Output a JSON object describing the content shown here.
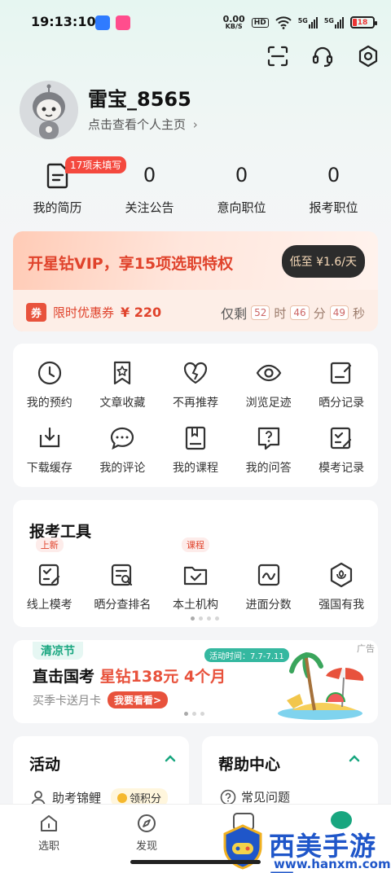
{
  "status_bar": {
    "time": "19:13:10",
    "net_speed_top": "0.00",
    "net_speed_bottom": "KB/S",
    "hd": "HD",
    "sig1": "5G",
    "sig2": "5G",
    "battery": "18"
  },
  "header_icons": [
    "scan-icon",
    "headset-icon",
    "settings-icon"
  ],
  "profile": {
    "username": "雷宝_8565",
    "subtitle": "点击查看个人主页",
    "subtitle_arrow": "›"
  },
  "stats": [
    {
      "value": "",
      "label": "我的简历",
      "badge": "17项未填写",
      "icon": "resume-icon"
    },
    {
      "value": "0",
      "label": "关注公告"
    },
    {
      "value": "0",
      "label": "意向职位"
    },
    {
      "value": "0",
      "label": "报考职位"
    }
  ],
  "vip": {
    "title": "开星钻VIP，享15项选职特权",
    "button": "低至 ¥1.6/天",
    "coupon_tag": "券",
    "coupon_text": "限时优惠券",
    "coupon_amount": "¥ 220",
    "countdown_prefix": "仅剩",
    "hours": "52",
    "hours_unit": "时",
    "minutes": "46",
    "minutes_unit": "分",
    "seconds": "49",
    "seconds_unit": "秒"
  },
  "quick_grid": [
    {
      "label": "我的预约",
      "icon": "clock-icon"
    },
    {
      "label": "文章收藏",
      "icon": "bookmark-star-icon"
    },
    {
      "label": "不再推荐",
      "icon": "broken-heart-icon"
    },
    {
      "label": "浏览足迹",
      "icon": "eye-icon"
    },
    {
      "label": "晒分记录",
      "icon": "edit-note-icon"
    },
    {
      "label": "下载缓存",
      "icon": "download-icon"
    },
    {
      "label": "我的评论",
      "icon": "comment-icon"
    },
    {
      "label": "我的课程",
      "icon": "course-book-icon"
    },
    {
      "label": "我的问答",
      "icon": "question-icon"
    },
    {
      "label": "模考记录",
      "icon": "exam-record-icon"
    }
  ],
  "tools": {
    "title": "报考工具",
    "items": [
      {
        "label": "线上模考",
        "tag": "上新",
        "icon": "mock-exam-icon"
      },
      {
        "label": "晒分查排名",
        "tag": "",
        "icon": "rank-search-icon"
      },
      {
        "label": "本土机构",
        "tag": "课程",
        "icon": "folder-check-icon"
      },
      {
        "label": "进面分数",
        "tag": "",
        "icon": "score-wave-icon"
      },
      {
        "label": "强国有我",
        "tag": "",
        "icon": "hexagon-flower-icon"
      }
    ]
  },
  "ad": {
    "label": "清凉节",
    "ad_mark": "广告",
    "activity_time": "活动时间：7.7-7.11",
    "headline_a": "直击国考",
    "headline_b": "星钻138元 4个月",
    "subline": "买季卡送月卡",
    "cta": "我要看看>"
  },
  "activity": {
    "title": "活动",
    "item": "助考锦鲤",
    "points_btn": "领积分"
  },
  "help": {
    "title": "帮助中心",
    "item": "常见问题"
  },
  "bottom_nav": [
    {
      "label": "选职",
      "icon": "home-icon"
    },
    {
      "label": "发现",
      "icon": "compass-icon"
    }
  ],
  "watermark": {
    "text": "西美手游网",
    "url": "www.hanxm.com"
  },
  "colors": {
    "accent_red": "#e0432c",
    "accent_green": "#18a67f"
  }
}
